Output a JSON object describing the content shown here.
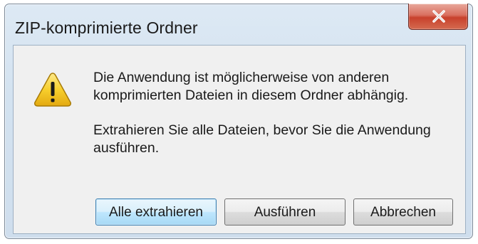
{
  "window": {
    "title": "ZIP-komprimierte Ordner",
    "close_glyph": "X"
  },
  "message": {
    "line1": "Die Anwendung ist möglicherweise von anderen komprimierten Dateien in diesem Ordner abhängig.",
    "line2": "Extrahieren Sie alle Dateien, bevor Sie die Anwendung ausführen."
  },
  "icon": {
    "name": "warning-icon",
    "color": "#f5c21b"
  },
  "buttons": {
    "extract_all": "Alle extrahieren",
    "run": "Ausführen",
    "cancel": "Abbrechen"
  }
}
